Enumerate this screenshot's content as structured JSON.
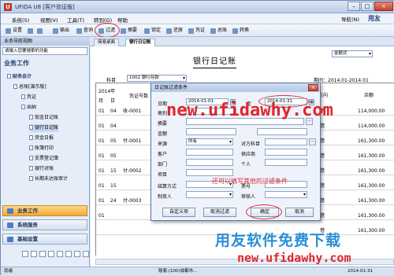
{
  "app": {
    "title": "UFIDA U8 [客户验证版]",
    "brand": "用友",
    "nav_label": "导航(N)"
  },
  "menu": [
    "系统(S)",
    "视图(V)",
    "工具(T)",
    "转到(G)",
    "帮助"
  ],
  "toolbar": [
    "设置",
    "输出",
    "查询",
    "过滤",
    "摘要",
    "锁定",
    "还原",
    "凭证",
    "总账",
    "转换"
  ],
  "left_panel": {
    "header": "业务导航视图",
    "search_placeholder": "请输入您要搜索的功能",
    "section": "业务工作",
    "tree": [
      {
        "label": "财务会计",
        "level": 0
      },
      {
        "label": "总账[演示版]",
        "level": 1
      },
      {
        "label": "凭证",
        "level": 2
      },
      {
        "label": "出纳",
        "level": 2
      },
      {
        "label": "现金日记账",
        "level": 3
      },
      {
        "label": "银行日记账",
        "level": 3
      },
      {
        "label": "资金日报",
        "level": 3
      },
      {
        "label": "账簿打印",
        "level": 3
      },
      {
        "label": "支票登记簿",
        "level": 3
      },
      {
        "label": "银行对账",
        "level": 3
      },
      {
        "label": "长期未达账审计",
        "level": 3
      }
    ],
    "nav_buttons": [
      "业务工作",
      "系统服务",
      "基础设置"
    ]
  },
  "tabs": [
    "简易桌面",
    "银行日记账"
  ],
  "ledger": {
    "title": "银行日记账",
    "subject_label": "科目",
    "subject_value": "1002 银行存款",
    "format_value": "金额式",
    "period": "期间：2014.01-2014.01",
    "header_year": "2014年",
    "header_month": "月",
    "header_day": "日",
    "header_voucher": "凭证号数",
    "header_direction": "方向",
    "header_balance": "余额",
    "rows": [
      {
        "m": "01",
        "d": "04",
        "v": "收-0001",
        "dir": "借",
        "bal": "114,000.00"
      },
      {
        "m": "01",
        "d": "04",
        "v": "",
        "dir": "借",
        "bal": "114,000.00"
      },
      {
        "m": "01",
        "d": "05",
        "v": "付-0001",
        "dir": "借",
        "bal": "161,300.00"
      },
      {
        "m": "01",
        "d": "05",
        "v": "",
        "dir": "借",
        "bal": "161,300.00"
      },
      {
        "m": "01",
        "d": "15",
        "v": "付-0002",
        "dir": "借",
        "bal": "161,300.00"
      },
      {
        "m": "01",
        "d": "15",
        "v": "",
        "dir": "借",
        "bal": "161,300.00"
      },
      {
        "m": "01",
        "d": "24",
        "v": "付-0003",
        "dir": "借",
        "bal": "161,300.00"
      },
      {
        "m": "01",
        "d": "",
        "v": "",
        "dir": "借",
        "bal": "161,300.00"
      },
      {
        "m": "",
        "d": "",
        "v": "",
        "dir": "借",
        "bal": "161,300.00"
      }
    ]
  },
  "dialog": {
    "title": "日记账过滤条件",
    "close": "×",
    "date_label": "日期",
    "date_from": "2014-01-01",
    "date_to": "2014-01-31",
    "to_sep": "至",
    "fields_left": [
      "类别",
      "摘要",
      "金额",
      "来源",
      "客户",
      "部门",
      "项目",
      "结算方式",
      "制单人"
    ],
    "fields_right": [
      "对方科目",
      "供应商",
      "个人",
      "票号",
      "审核人"
    ],
    "source_value": "所有",
    "buttons": [
      "自定义项",
      "取消过滤",
      "确定",
      "取消"
    ]
  },
  "overlay": {
    "url1": "new.ufidawhy.com",
    "tip": "还可以填写其他的过滤条件",
    "big": "用友软件免费下载",
    "url2": "new.ufidawhy.com"
  },
  "status": {
    "left": "就绪",
    "middle": "账套:(100)成都市...",
    "right": "2014-01-31"
  }
}
